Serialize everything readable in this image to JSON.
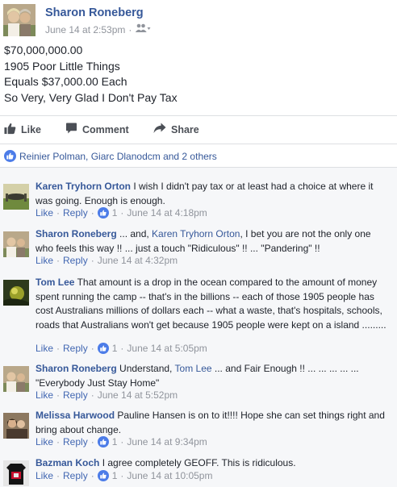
{
  "post": {
    "author": "Sharon Roneberg",
    "timestamp": "June 14 at 2:53pm",
    "lines": [
      "$70,000,000.00",
      "1905 Poor Little Things",
      "Equals $37,000.00 Each",
      "So Very, Very Glad I Don't Pay Tax"
    ]
  },
  "actions": {
    "like": "Like",
    "comment": "Comment",
    "share": "Share"
  },
  "reactions": {
    "text": "Reinier Polman, Giarc Dlanodcm and 2 others"
  },
  "comments": [
    {
      "name": "Karen Tryhorn Orton",
      "text": " I wish I didn't pay tax or at least had a choice at where it was going. Enough is enough.",
      "like": "Like",
      "reply": "Reply",
      "likes": "1",
      "time": "June 14 at 4:18pm"
    },
    {
      "name": "Sharon Roneberg",
      "text_before": " ... and, ",
      "tag": "Karen Tryhorn Orton",
      "text": ", I bet you are not the only one who feels this way !! ... just a touch \"Ridiculous\" !! ... \"Pandering\" !!",
      "like": "Like",
      "reply": "Reply",
      "time": "June 14 at 4:32pm"
    },
    {
      "name": "Tom Lee",
      "text": " That amount is a drop in the ocean compared to the amount of money spent running the camp -- that's in the billions -- each of those 1905 people has cost Australians millions of dollars each -- what a waste, that's hospitals, schools, roads that Australians won't get because 1905 people were kept on a island .........",
      "like": "Like",
      "reply": "Reply",
      "likes": "1",
      "time": "June 14 at 5:05pm"
    },
    {
      "name": "Sharon Roneberg",
      "text_before": " Understand, ",
      "tag": "Tom Lee",
      "text": " ... and Fair Enough !! ... ... ... ... ... \"Everybody Just Stay Home\"",
      "like": "Like",
      "reply": "Reply",
      "time": "June 14 at 5:52pm"
    },
    {
      "name": "Melissa Harwood",
      "text": " Pauline Hansen is on to it!!!! Hope she can set things right and bring about change.",
      "like": "Like",
      "reply": "Reply",
      "likes": "1",
      "time": "June 14 at 9:34pm"
    },
    {
      "name": "Bazman Koch",
      "text": " I agree completely GEOFF. This is ridiculous.",
      "like": "Like",
      "reply": "Reply",
      "likes": "1",
      "time": "June 14 at 10:05pm"
    }
  ],
  "colors": {
    "link": "#365899",
    "meta": "#90949c",
    "like_blue": "#4267b2",
    "comment_bg": "#f6f7f9"
  },
  "icons": [
    "friends-audience-icon",
    "like-thumb-icon",
    "comment-bubble-icon",
    "share-arrow-icon",
    "like-reaction-icon"
  ]
}
